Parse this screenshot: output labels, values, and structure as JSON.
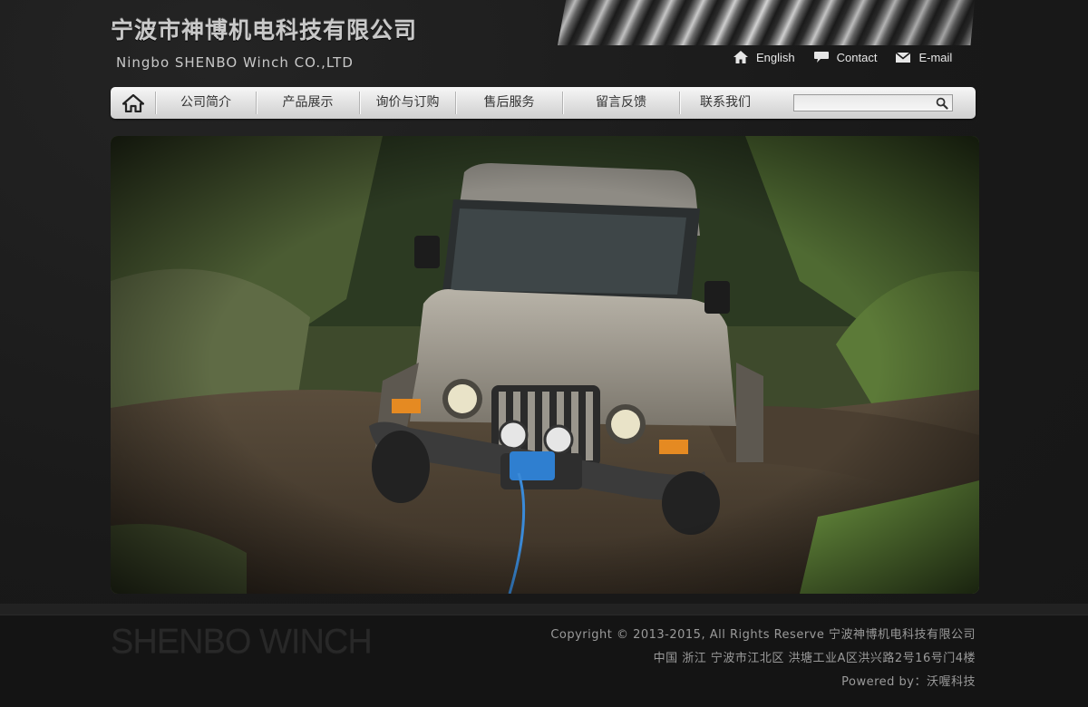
{
  "header": {
    "company_cn": "宁波市神博机电科技有限公司",
    "company_en": "Ningbo SHENBO Winch CO.,LTD",
    "links": [
      {
        "label": "English",
        "icon": "home-icon"
      },
      {
        "label": "Contact",
        "icon": "speech-bubble-icon"
      },
      {
        "label": "E-mail",
        "icon": "envelope-icon"
      }
    ]
  },
  "nav": {
    "home_icon": "home-icon",
    "items": [
      "公司简介",
      "产品展示",
      "询价与订购",
      "售后服务",
      "留言反馈",
      "联系我们"
    ],
    "search": {
      "placeholder": "",
      "value": "",
      "icon": "search-icon"
    }
  },
  "banner": {
    "subject": "jeep-with-winch-in-mud"
  },
  "footer": {
    "watermark": "SHENBO WINCH",
    "copyright": "Copyright © 2013-2015, All Rights Reserve 宁波神博机电科技有限公司",
    "address": "中国 浙江 宁波市江北区 洪塘工业A区洪兴路2号16号门4楼",
    "powered": "Powered by：沃喔科技"
  },
  "colors": {
    "background": "#191919",
    "nav_bar": "#e2e2e2",
    "footer": "#141414",
    "text_light": "#e8e8e8"
  }
}
